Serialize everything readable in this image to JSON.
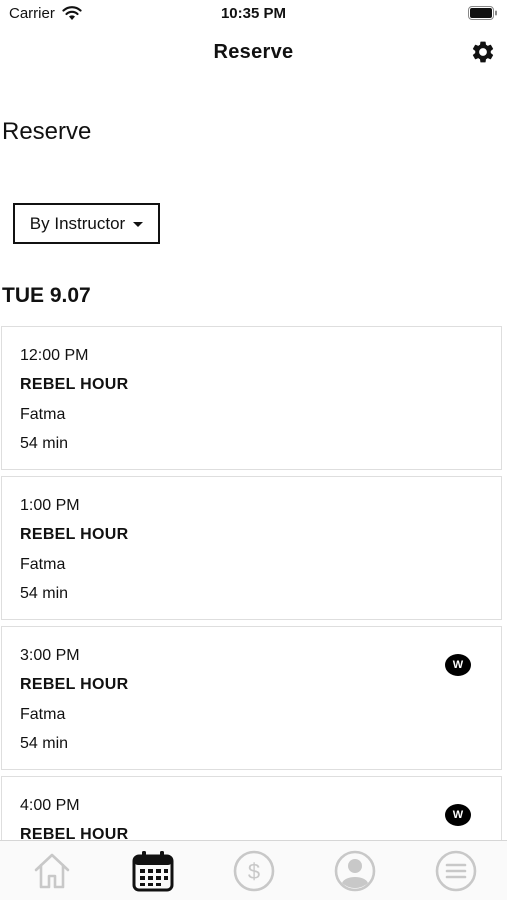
{
  "status_bar": {
    "carrier": "Carrier",
    "time": "10:35 PM"
  },
  "nav": {
    "title": "Reserve",
    "settings_icon": "gear-icon"
  },
  "page": {
    "title": "Reserve"
  },
  "filter": {
    "selected": "By Instructor"
  },
  "schedule": {
    "date_label": "TUE 9.07",
    "classes": [
      {
        "time": "12:00 PM",
        "name": "REBEL HOUR",
        "instructor": "Fatma",
        "duration": "54 min",
        "badge": ""
      },
      {
        "time": "1:00 PM",
        "name": "REBEL HOUR",
        "instructor": "Fatma",
        "duration": "54 min",
        "badge": ""
      },
      {
        "time": "3:00 PM",
        "name": "REBEL HOUR",
        "instructor": "Fatma",
        "duration": "54 min",
        "badge": "W"
      },
      {
        "time": "4:00 PM",
        "name": "REBEL HOUR",
        "instructor": "",
        "duration": "",
        "badge": "W"
      }
    ]
  },
  "tab_bar": {
    "tabs": [
      {
        "id": "home",
        "icon": "home-icon",
        "active": false
      },
      {
        "id": "schedule",
        "icon": "calendar-icon",
        "active": true
      },
      {
        "id": "pricing",
        "icon": "dollar-icon",
        "active": false
      },
      {
        "id": "profile",
        "icon": "profile-icon",
        "active": false
      },
      {
        "id": "menu",
        "icon": "menu-icon",
        "active": false
      }
    ],
    "active_color": "#111111",
    "inactive_color": "#c8c8c8"
  }
}
